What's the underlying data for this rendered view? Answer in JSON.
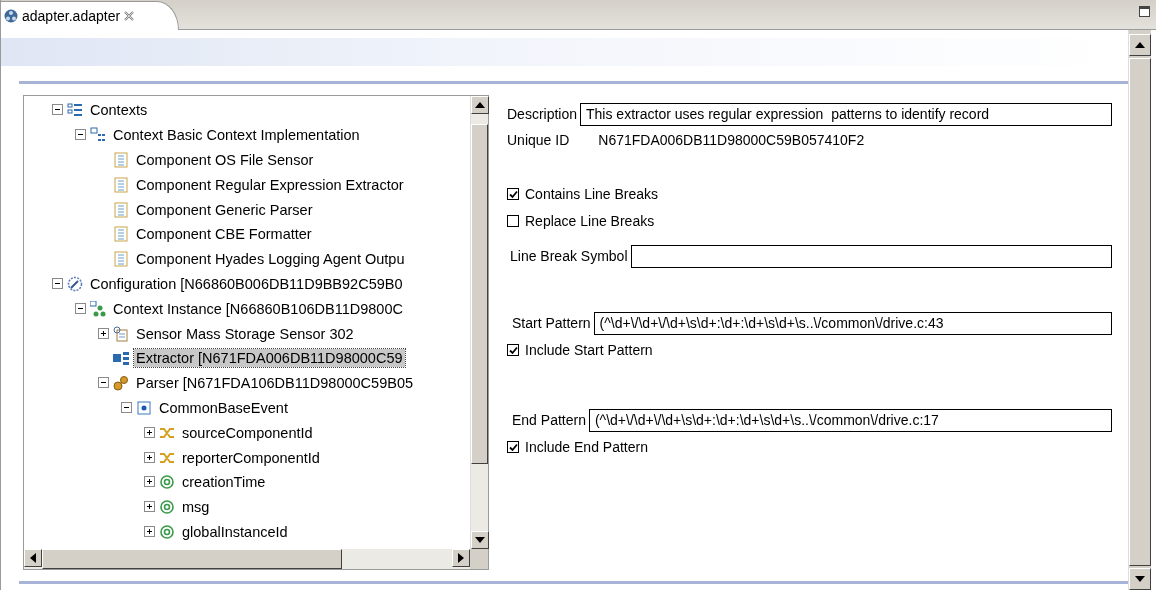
{
  "editor_tab": {
    "title": "adapter.adapter",
    "selected": true
  },
  "tree": {
    "items": [
      {
        "label": "Contexts",
        "kind": "contexts",
        "expanded": true,
        "selected": false,
        "children": [
          {
            "label": "Context Basic Context Implementation",
            "kind": "context",
            "expanded": true,
            "selected": false,
            "children": [
              {
                "label": "Component OS File Sensor",
                "kind": "component",
                "selected": false
              },
              {
                "label": "Component Regular Expression Extractor",
                "kind": "component",
                "selected": false
              },
              {
                "label": "Component Generic Parser",
                "kind": "component",
                "selected": false
              },
              {
                "label": "Component CBE Formatter",
                "kind": "component",
                "selected": false
              },
              {
                "label": "Component Hyades Logging Agent Outpu",
                "kind": "component",
                "selected": false
              }
            ]
          }
        ]
      },
      {
        "label": "Configuration [N66860B006DB11D9BB92C59B0",
        "kind": "configuration",
        "expanded": true,
        "selected": false,
        "children": [
          {
            "label": "Context Instance [N66860B106DB11D9800C",
            "kind": "context-instance",
            "expanded": true,
            "selected": false,
            "children": [
              {
                "label": "Sensor Mass Storage Sensor 302",
                "kind": "sensor",
                "expanded": false,
                "selected": false
              },
              {
                "label": "Extractor [N671FDA006DB11D98000C59",
                "kind": "extractor",
                "selected": true
              },
              {
                "label": "Parser [N671FDA106DB11D98000C59B05",
                "kind": "parser",
                "expanded": true,
                "selected": false,
                "children": [
                  {
                    "label": "CommonBaseEvent",
                    "kind": "event",
                    "expanded": true,
                    "selected": false,
                    "children": [
                      {
                        "label": "sourceComponentId",
                        "kind": "reference",
                        "expanded": false,
                        "selected": false
                      },
                      {
                        "label": "reporterComponentId",
                        "kind": "reference",
                        "expanded": false,
                        "selected": false
                      },
                      {
                        "label": "creationTime",
                        "kind": "attribute",
                        "expanded": false,
                        "selected": false
                      },
                      {
                        "label": "msg",
                        "kind": "attribute",
                        "expanded": false,
                        "selected": false
                      },
                      {
                        "label": "globalInstanceId",
                        "kind": "attribute",
                        "expanded": false,
                        "selected": false
                      }
                    ]
                  }
                ]
              }
            ]
          }
        ]
      }
    ]
  },
  "form": {
    "description": {
      "label": "Description",
      "value": "This extractor uses regular expression  patterns to identify record"
    },
    "unique_id": {
      "label": "Unique ID",
      "value": "N671FDA006DB11D98000C59B057410F2"
    },
    "contains_line_breaks": {
      "label": "Contains Line Breaks",
      "checked": true
    },
    "replace_line_breaks": {
      "label": "Replace Line Breaks",
      "checked": false
    },
    "line_break_symbol": {
      "label": "Line Break Symbol"
    },
    "start_pattern": {
      "label": "Start Pattern",
      "value": "(^\\d+\\/\\d+\\/\\d+\\s\\d+:\\d+:\\d+\\s\\d+\\s..\\/common\\/drive.c:43"
    },
    "include_start_pattern": {
      "label": "Include Start Pattern",
      "checked": true
    },
    "end_pattern": {
      "label": "End Pattern",
      "value": "(^\\d+\\/\\d+\\/\\d+\\s\\d+:\\d+:\\d+\\s\\d+\\s..\\/common\\/drive.c:17"
    },
    "include_end_pattern": {
      "label": "Include End Pattern",
      "checked": true
    }
  }
}
